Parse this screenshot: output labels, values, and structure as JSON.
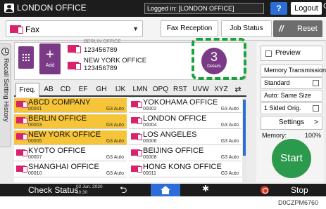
{
  "topbar": {
    "title": "LONDON OFFICE",
    "logged_in": "Logged in: [LONDON OFFICE]",
    "help": "?",
    "logout": "Logout",
    "corner": "C"
  },
  "funcbar": {
    "function": "Fax",
    "fax_reception": "Fax Reception",
    "job_status": "Job Status",
    "reset": "Reset"
  },
  "recall_tab": "Recall Setting History",
  "destinations": {
    "add_label": "Add",
    "items": [
      {
        "name": "BERLIN OFFICE",
        "number": "123456789"
      },
      {
        "name": "NEW YORK OFFICE",
        "number": "123456789"
      }
    ],
    "details_count": "3",
    "details_label": "Details"
  },
  "filter_tabs": [
    "Freq.",
    "AB",
    "CD",
    "EF",
    "GH",
    "IJK",
    "LMN",
    "OPQ",
    "RST",
    "UVW",
    "XYZ"
  ],
  "address_book": [
    {
      "name": "ABCD COMPANY",
      "number": "00001",
      "mode": "G3 Auto",
      "selected": true
    },
    {
      "name": "YOKOHAMA OFFICE",
      "number": "00002",
      "mode": "G3 Auto",
      "selected": false
    },
    {
      "name": "BERLIN OFFICE",
      "number": "00003",
      "mode": "G3 Auto",
      "selected": true
    },
    {
      "name": "LONDON OFFICE",
      "number": "00004",
      "mode": "G3 Auto",
      "selected": false
    },
    {
      "name": "NEW YORK OFFICE",
      "number": "00005",
      "mode": "G3 Auto",
      "selected": true
    },
    {
      "name": "LOS ANGELES",
      "number": "00006",
      "mode": "G3 Auto",
      "selected": false
    },
    {
      "name": "KYOTO OFFICE",
      "number": "00007",
      "mode": "G3 Auto",
      "selected": false
    },
    {
      "name": "BEIJING OFFICE",
      "number": "00008",
      "mode": "G3 Auto",
      "selected": false
    },
    {
      "name": "SHANGHAI  OFFICE",
      "number": "00010",
      "mode": "G3 Auto",
      "selected": false
    },
    {
      "name": "HONG KONG OFFICE",
      "number": "00011",
      "mode": "G3 Auto",
      "selected": false
    }
  ],
  "right_panel": {
    "preview": "Preview",
    "memory_transmission": "Memory Transmission",
    "standard": "Standard",
    "auto_same_size": "Auto: Same Size",
    "orig": "1 Sided Orig.",
    "settings": "Settings",
    "memory_label": "Memory:",
    "memory_value": "100%",
    "start": "Start"
  },
  "bottombar": {
    "check_status": "Check Status",
    "date": "02 Jun. 2020",
    "time": "10:30",
    "stop": "Stop"
  },
  "figure_code": "D0CZPM6760"
}
